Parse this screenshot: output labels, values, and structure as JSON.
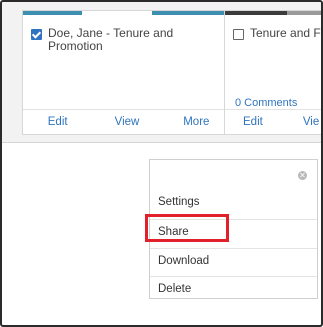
{
  "cards": [
    {
      "title": "Doe, Jane - Tenure and Promotion",
      "checked": true,
      "actions": {
        "edit": "Edit",
        "view": "View",
        "more": "More"
      },
      "bar_colors": [
        "#3d8fb0",
        "#ffffff",
        "#3d8fb0"
      ]
    },
    {
      "title": "Tenure and F Portfolio",
      "checked": false,
      "comments": "0 Comments",
      "actions": {
        "edit": "Edit",
        "view": "Vie"
      },
      "bar_colors": [
        "#3b3b3b",
        "#9a9a9a"
      ]
    }
  ],
  "menu": {
    "close_icon": "close-circle-icon",
    "items": [
      "Settings",
      "Share",
      "Download",
      "Delete"
    ]
  },
  "colors": {
    "link": "#2f74c0",
    "highlight": "#e2202a"
  }
}
